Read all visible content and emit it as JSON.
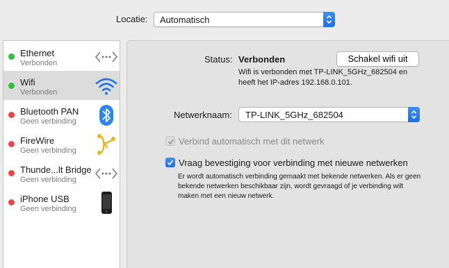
{
  "location": {
    "label": "Locatie:",
    "value": "Automatisch"
  },
  "services": [
    {
      "name": "Ethernet",
      "status": "Verbonden",
      "dot_color": "#28c33a",
      "icon": "ethernet-icon"
    },
    {
      "name": "Wifi",
      "status": "Verbonden",
      "dot_color": "#28c33a",
      "icon": "wifi-icon",
      "selected": true
    },
    {
      "name": "Bluetooth PAN",
      "status": "Geen verbinding",
      "dot_color": "#e8464b",
      "icon": "bluetooth-icon"
    },
    {
      "name": "FireWire",
      "status": "Geen verbinding",
      "dot_color": "#e8464b",
      "icon": "firewire-icon"
    },
    {
      "name": "Thunde...lt Bridge",
      "status": "Geen verbinding",
      "dot_color": "#e8464b",
      "icon": "thunderbolt-bridge-icon"
    },
    {
      "name": "iPhone USB",
      "status": "Geen verbinding",
      "dot_color": "#e8464b",
      "icon": "iphone-icon"
    }
  ],
  "detail": {
    "status_label": "Status:",
    "status_value": "Verbonden",
    "toggle_wifi_label": "Schakel wifi uit",
    "status_description": "Wifi is verbonden met TP-LINK_5GHz_682504 en heeft het IP-adres 192.168.0.101.",
    "network_label": "Netwerknaam:",
    "network_value": "TP-LINK_5GHz_682504",
    "auto_join_label": "Verbind automatisch met dit netwerk",
    "auto_join_checked": true,
    "ask_join_label": "Vraag bevestiging voor verbinding met nieuwe netwerken",
    "ask_join_checked": true,
    "ask_join_help": "Er wordt automatisch verbinding gemaakt met bekende netwerken. Als er geen bekende netwerken beschikbaar zijn, wordt gevraagd of je verbinding wilt maken met een nieuw netwerk."
  },
  "colors": {
    "accent": "#1f74ee",
    "connected": "#28c33a",
    "disconnected": "#e8464b"
  }
}
